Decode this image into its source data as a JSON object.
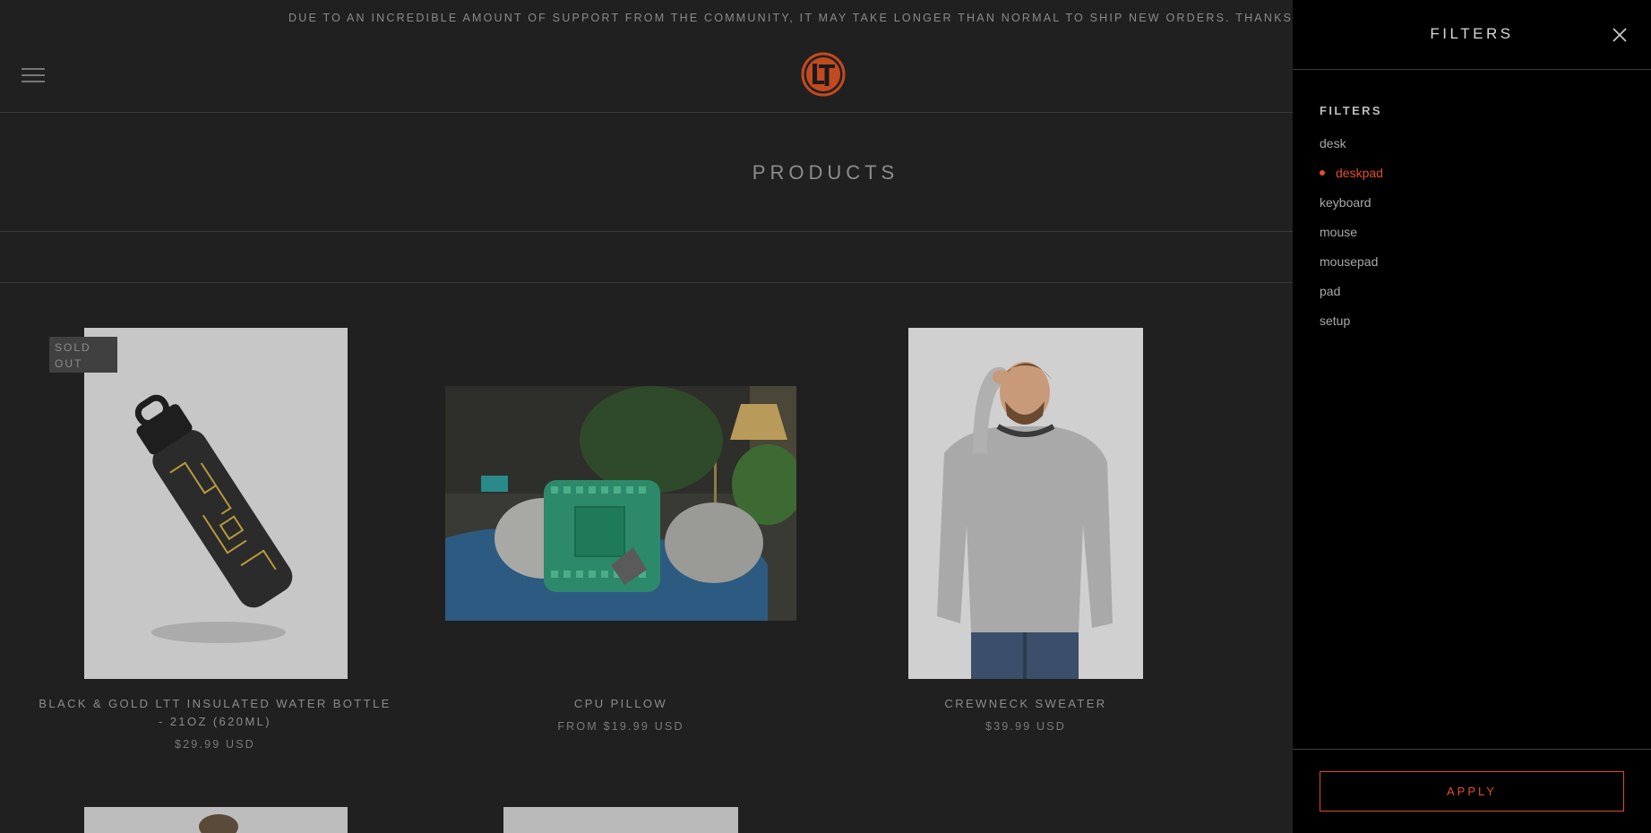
{
  "announcement": "DUE TO AN INCREDIBLE AMOUNT OF SUPPORT FROM THE COMMUNITY, IT MAY TAKE LONGER THAN NORMAL TO SHIP NEW ORDERS. THANKS FOR YOU",
  "header": {
    "logo_text": "LTT",
    "menu_icon": "hamburger-icon"
  },
  "page_title": "PRODUCTS",
  "products": [
    {
      "name_line1": "BLACK & GOLD LTT INSULATED WATER BOTTLE",
      "name_line2": "- 21OZ (620ML)",
      "price": "$29.99 USD",
      "badge_line1": "SOLD",
      "badge_line2": "OUT"
    },
    {
      "name_line1": "CPU PILLOW",
      "price": "FROM $19.99 USD"
    },
    {
      "name_line1": "CREWNECK SWEATER",
      "price": "$39.99 USD"
    }
  ],
  "drawer": {
    "title": "FILTERS",
    "section_label": "FILTERS",
    "items": [
      {
        "label": "desk",
        "active": false
      },
      {
        "label": "deskpad",
        "active": true
      },
      {
        "label": "keyboard",
        "active": false
      },
      {
        "label": "mouse",
        "active": false
      },
      {
        "label": "mousepad",
        "active": false
      },
      {
        "label": "pad",
        "active": false
      },
      {
        "label": "setup",
        "active": false
      }
    ],
    "apply_label": "APPLY",
    "close_icon": "close-icon"
  },
  "colors": {
    "accent": "#e0512a",
    "background": "#202020",
    "drawer": "#000000"
  }
}
